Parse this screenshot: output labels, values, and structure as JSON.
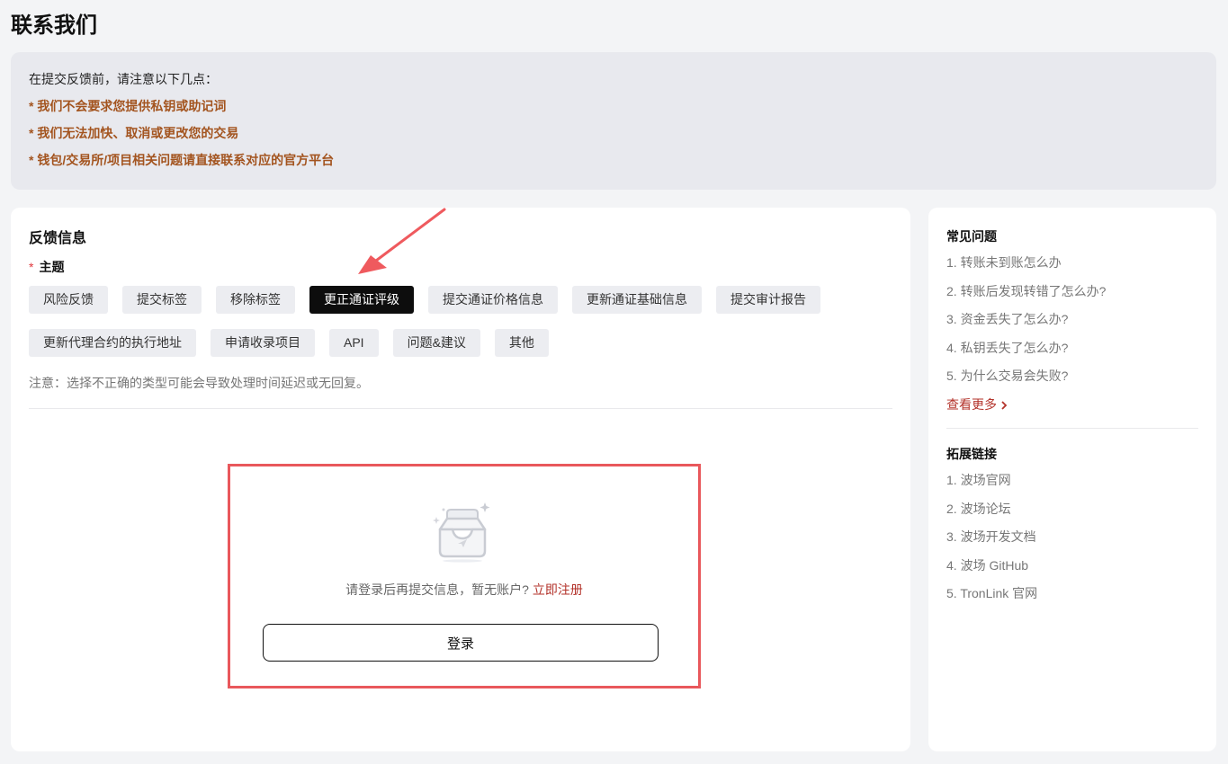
{
  "page_title": "联系我们",
  "notice": {
    "intro": "在提交反馈前，请注意以下几点：",
    "items": [
      "* 我们不会要求您提供私钥或助记词",
      "* 我们无法加快、取消或更改您的交易",
      "* 钱包/交易所/项目相关问题请直接联系对应的官方平台"
    ]
  },
  "feedback": {
    "title": "反馈信息",
    "required_mark": "*",
    "topic_label": "主题",
    "topics_row1": [
      "风险反馈",
      "提交标签",
      "移除标签",
      "更正通证评级",
      "提交通证价格信息",
      "更新通证基础信息",
      "提交审计报告"
    ],
    "topics_row2": [
      "更新代理合约的执行地址",
      "申请收录项目",
      "API",
      "问题&建议",
      "其他"
    ],
    "selected_topic": "更正通证评级",
    "tip": "注意：选择不正确的类型可能会导致处理时间延迟或无回复。",
    "login_prompt": "请登录后再提交信息，暂无账户?",
    "register_link": "立即注册",
    "login_button": "登录"
  },
  "faq": {
    "title": "常见问题",
    "items": [
      "1. 转账未到账怎么办",
      "2. 转账后发现转错了怎么办?",
      "3. 资金丢失了怎么办?",
      "4. 私钥丢失了怎么办?",
      "5. 为什么交易会失败?"
    ],
    "more": "查看更多",
    "more_icon": "chevron-right-icon"
  },
  "links": {
    "title": "拓展链接",
    "items": [
      "1. 波场官网",
      "2. 波场论坛",
      "3. 波场开发文档",
      "4. 波场 GitHub",
      "5. TronLink 官网"
    ]
  },
  "colors": {
    "notice_text": "#a3541f",
    "accent_red": "#b3322a",
    "highlight_box": "#e9585c",
    "active_tag_bg": "#0d0d0d"
  }
}
